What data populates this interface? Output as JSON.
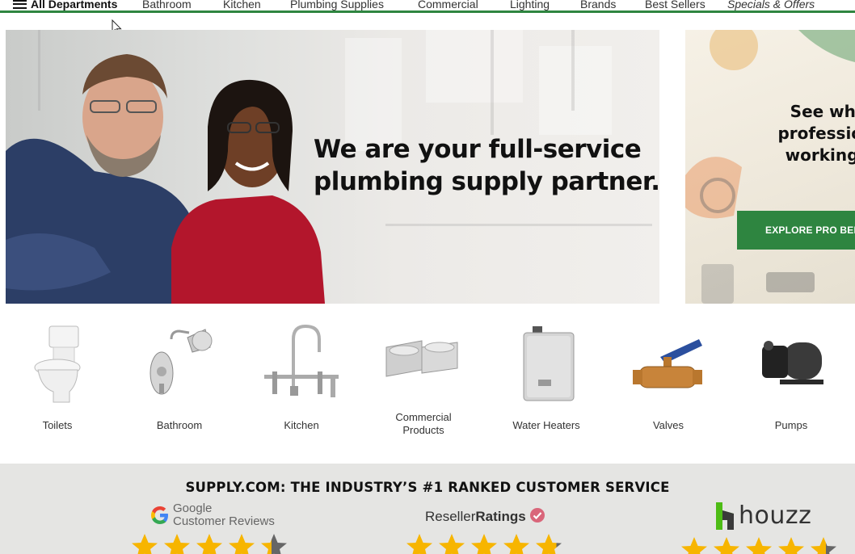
{
  "nav": {
    "all_departments": "All Departments",
    "items": [
      "Bathroom",
      "Kitchen",
      "Plumbing Supplies",
      "Commercial",
      "Lighting",
      "Brands",
      "Best Sellers",
      "Specials & Offers"
    ]
  },
  "hero": {
    "headline_line1": "We are your full-service",
    "headline_line2": "plumbing supply partner."
  },
  "promo": {
    "headline_line1": "See why tr",
    "headline_line2": "professionals",
    "headline_line3": "working wit",
    "button_label": "EXPLORE PRO BEN"
  },
  "categories": [
    {
      "label": "Toilets",
      "icon": "toilet-icon"
    },
    {
      "label": "Bathroom",
      "icon": "shower-icon"
    },
    {
      "label": "Kitchen",
      "icon": "kitchen-faucet-icon"
    },
    {
      "label_line1": "Commercial",
      "label_line2": "Products",
      "icon": "drinking-fountain-icon"
    },
    {
      "label": "Water Heaters",
      "icon": "water-heater-icon"
    },
    {
      "label": "Valves",
      "icon": "valve-icon"
    },
    {
      "label": "Pumps",
      "icon": "pump-icon"
    }
  ],
  "reviews": {
    "title": "SUPPLY.COM: THE INDUSTRY’S #1 RANKED CUSTOMER SERVICE",
    "google": {
      "brand": "Google",
      "subtitle": "Customer Reviews"
    },
    "reseller": {
      "brand_plain": "Reseller",
      "brand_bold": "Ratings"
    },
    "houzz": {
      "brand": "houzz"
    }
  },
  "colors": {
    "accent_green": "#2e8540",
    "star_yellow": "#f7b500",
    "band_gray": "#e5e5e3"
  }
}
